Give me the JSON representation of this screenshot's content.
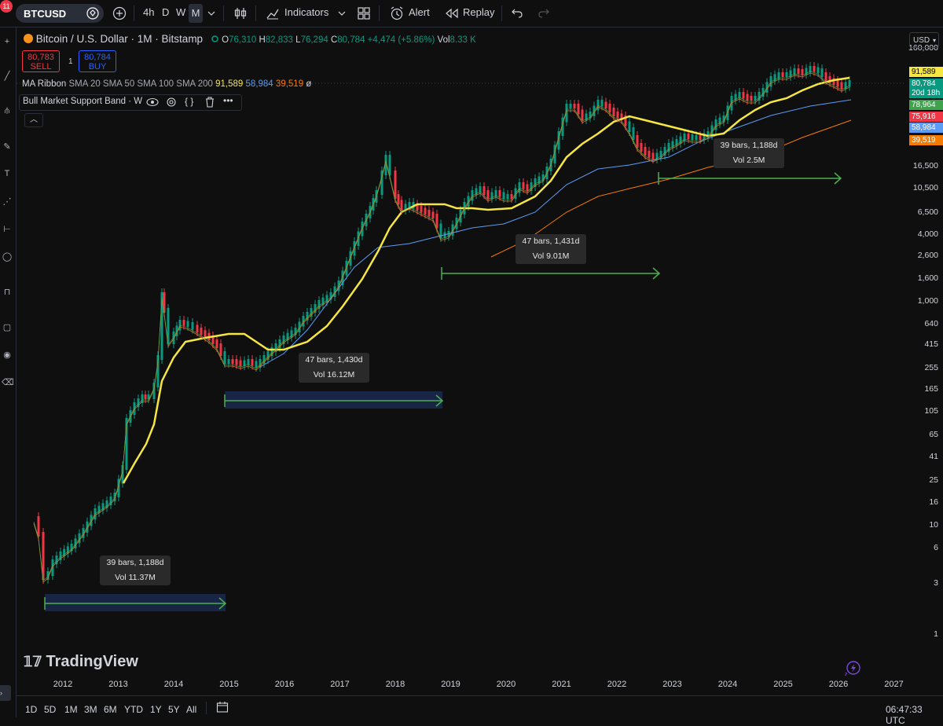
{
  "toolbar": {
    "notification_count": "11",
    "symbol": "BTCUSD",
    "intervals": [
      "4h",
      "D",
      "W",
      "M"
    ],
    "active_interval": "M",
    "indicators_label": "Indicators",
    "alert_label": "Alert",
    "replay_label": "Replay"
  },
  "legend": {
    "title": "Bitcoin / U.S. Dollar · 1M · Bitstamp",
    "o_label": "O",
    "o": "76,310",
    "h_label": "H",
    "h": "82,833",
    "l_label": "L",
    "l": "76,294",
    "c_label": "C",
    "c": "80,784",
    "change": "+4,474 (+5.86%)",
    "vol_label": "Vol",
    "vol": "8.33 K"
  },
  "trade": {
    "sell_price": "80,783",
    "sell_label": "SELL",
    "spread": "1",
    "buy_price": "80,784",
    "buy_label": "BUY"
  },
  "indicators": {
    "ma_ribbon_label": "MA Ribbon",
    "ma_ribbon_params": "SMA 20 SMA 50 SMA 100 SMA 200",
    "ma_values": [
      "91,589",
      "58,984",
      "39,519"
    ],
    "ma_suffix": "ø",
    "bull_band_label": "Bull Market Support Band · W"
  },
  "price_axis": {
    "currency": "USD",
    "labels": [
      "160,000",
      "16,500",
      "10,500",
      "6,500",
      "4,000",
      "2,600",
      "1,600",
      "1,000",
      "640",
      "415",
      "255",
      "165",
      "105",
      "65",
      "41",
      "25",
      "16",
      "10",
      "6",
      "3",
      "1"
    ],
    "badges": [
      {
        "text": "91,589",
        "color": "#f5e642",
        "textColor": "#000000"
      },
      {
        "text": "80,784",
        "color": "#089981",
        "textColor": "#ffffff"
      },
      {
        "text": "20d 18h",
        "color": "#089981",
        "textColor": "#ffffff"
      },
      {
        "text": "78,964",
        "color": "#3fa34d",
        "textColor": "#ffffff"
      },
      {
        "text": "75,916",
        "color": "#f23645",
        "textColor": "#ffffff"
      },
      {
        "text": "58,984",
        "color": "#5b9cf6",
        "textColor": "#ffffff"
      },
      {
        "text": "39,519",
        "color": "#f57c00",
        "textColor": "#ffffff"
      }
    ]
  },
  "time_axis": {
    "labels": [
      "2012",
      "2013",
      "2014",
      "2015",
      "2016",
      "2017",
      "2018",
      "2019",
      "2020",
      "2021",
      "2022",
      "2023",
      "2024",
      "2025",
      "2026",
      "2027"
    ]
  },
  "annotations": [
    {
      "bars": "39 bars, 1,188d",
      "vol": "Vol 11.37M"
    },
    {
      "bars": "47 bars, 1,430d",
      "vol": "Vol 16.12M"
    },
    {
      "bars": "47 bars, 1,431d",
      "vol": "Vol 9.01M"
    },
    {
      "bars": "39 bars, 1,188d",
      "vol": "Vol 2.5M"
    }
  ],
  "watermark": "TradingView",
  "bottom": {
    "ranges": [
      "1D",
      "5D",
      "1M",
      "3M",
      "6M",
      "YTD",
      "1Y",
      "5Y",
      "All"
    ],
    "clock": "06:47:33 UTC"
  },
  "colors": {
    "up": "#089981",
    "down": "#f23645",
    "sma20": "#f5e642",
    "sma50": "#5b9cf6",
    "sma100": "#f57c00",
    "arrow": "#4caf50"
  }
}
